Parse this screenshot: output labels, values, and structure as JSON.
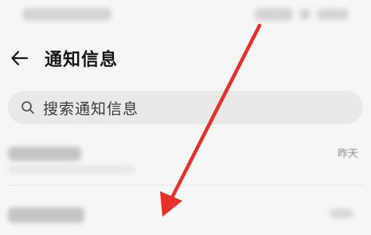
{
  "header": {
    "title": "通知信息"
  },
  "search": {
    "placeholder": "搜索通知信息"
  },
  "list": {
    "items": [
      {
        "time": "昨天"
      }
    ]
  },
  "icons": {
    "back": "arrow-left-icon",
    "search": "search-icon"
  },
  "colors": {
    "background": "#f6f6f6",
    "search_bg": "#e9e9e9",
    "annotation_arrow": "#e8302a"
  }
}
